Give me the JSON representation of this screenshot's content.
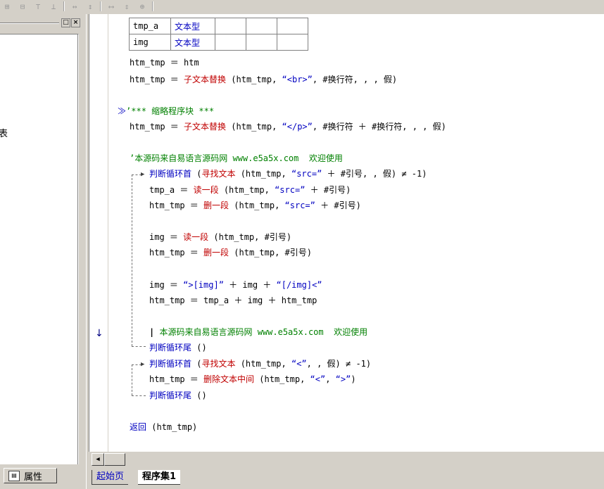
{
  "toolbar": {
    "buttons": [
      "align-left-icon",
      "align-center-icon",
      "align-top-icon",
      "align-right-icon",
      "space-horizontal-icon",
      "space-vertical-icon",
      "same-width-icon",
      "same-height-icon",
      "same-size-icon"
    ]
  },
  "left_panel": {
    "props_tab_label": "属性",
    "clipped_char": "表",
    "minimize_glyph": "□",
    "close_glyph": "×"
  },
  "var_table": {
    "rows": [
      {
        "name": "tmp_a",
        "type": "文本型"
      },
      {
        "name": "img",
        "type": "文本型"
      }
    ]
  },
  "code": {
    "l1": "htm_tmp ＝ htm",
    "l2_a": "htm_tmp ＝ ",
    "l2_fn": "子文本替换",
    "l2_b": " (htm_tmp, ",
    "l2_s": "“<br>”",
    "l2_c": ", #换行符, , , 假)",
    "l3_mark": "≫",
    "l3_cm": "’*** 缩略程序块 ***",
    "l4_a": "htm_tmp ＝ ",
    "l4_fn": "子文本替换",
    "l4_b": " (htm_tmp, ",
    "l4_s": "“</p>”",
    "l4_c": ", #换行符 ＋ #换行符, , , 假)",
    "l5_cm": "’本源码来自易语言源码网 www.e5a5x.com  欢迎使用",
    "l6_kw": "判断循环首",
    "l6_a": " (",
    "l6_fn": "寻找文本",
    "l6_b": " (htm_tmp, ",
    "l6_s": "“src=”",
    "l6_c": " ＋ #引号, , 假) ≠ -1)",
    "l7_a": "tmp_a ＝ ",
    "l7_fn": "读一段",
    "l7_b": " (htm_tmp, ",
    "l7_s": "“src=”",
    "l7_c": " ＋ #引号)",
    "l8_a": "htm_tmp ＝ ",
    "l8_fn": "删一段",
    "l8_b": " (htm_tmp, ",
    "l8_s": "“src=”",
    "l8_c": " ＋ #引号)",
    "l9_a": "img ＝ ",
    "l9_fn": "读一段",
    "l9_b": " (htm_tmp, #引号)",
    "l10_a": "htm_tmp ＝ ",
    "l10_fn": "删一段",
    "l10_b": " (htm_tmp, #引号)",
    "l11_a": "img ＝ ",
    "l11_s1": "“>[img]”",
    "l11_b": " ＋ img ＋ ",
    "l11_s2": "“[/img]<”",
    "l12": "htm_tmp ＝ tmp_a ＋ img ＋ htm_tmp",
    "l13_cm": "本源码来自易语言源码网 www.e5a5x.com  欢迎使用",
    "l14_kw": "判断循环尾",
    "l14_b": " ()",
    "l15_kw": "判断循环首",
    "l15_a": " (",
    "l15_fn": "寻找文本",
    "l15_b": " (htm_tmp, ",
    "l15_s": "“<”",
    "l15_c": ", , 假) ≠ -1)",
    "l16_a": "htm_tmp ＝ ",
    "l16_fn": "删除文本中间",
    "l16_b": " (htm_tmp, ",
    "l16_s1": "“<”",
    "l16_c": ", ",
    "l16_s2": "“>”",
    "l16_d": ")",
    "l17_kw": "判断循环尾",
    "l17_b": " ()",
    "l18_kw": "返回",
    "l18_b": " (htm_tmp)",
    "gutter_marker": "↓"
  },
  "tabs": {
    "start": "起始页",
    "program": "程序集1"
  },
  "colors": {
    "keyword": "#0000c0",
    "function": "#c00000",
    "comment": "#008000"
  }
}
